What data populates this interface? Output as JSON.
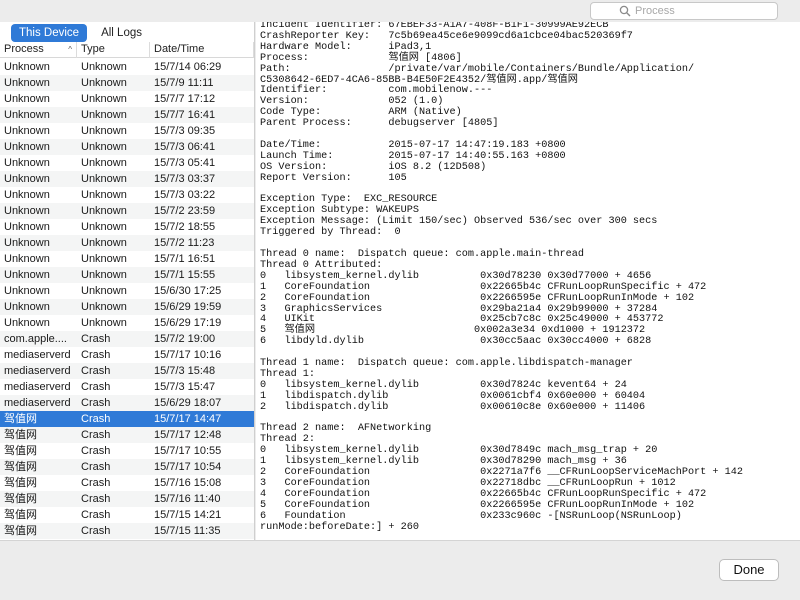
{
  "toolbar": {
    "search_placeholder": "Process",
    "search_icon": "magnifier"
  },
  "tabs": {
    "this_device": "This Device",
    "all_logs": "All Logs"
  },
  "table": {
    "columns": [
      "Process",
      "Type",
      "Date/Time"
    ],
    "sort_indicator": "^",
    "rows": [
      [
        "Unknown",
        "Unknown",
        "15/7/14 06:29"
      ],
      [
        "Unknown",
        "Unknown",
        "15/7/9 11:11"
      ],
      [
        "Unknown",
        "Unknown",
        "15/7/7 17:12"
      ],
      [
        "Unknown",
        "Unknown",
        "15/7/7 16:41"
      ],
      [
        "Unknown",
        "Unknown",
        "15/7/3 09:35"
      ],
      [
        "Unknown",
        "Unknown",
        "15/7/3 06:41"
      ],
      [
        "Unknown",
        "Unknown",
        "15/7/3 05:41"
      ],
      [
        "Unknown",
        "Unknown",
        "15/7/3 03:37"
      ],
      [
        "Unknown",
        "Unknown",
        "15/7/3 03:22"
      ],
      [
        "Unknown",
        "Unknown",
        "15/7/2 23:59"
      ],
      [
        "Unknown",
        "Unknown",
        "15/7/2 18:55"
      ],
      [
        "Unknown",
        "Unknown",
        "15/7/2 11:23"
      ],
      [
        "Unknown",
        "Unknown",
        "15/7/1 16:51"
      ],
      [
        "Unknown",
        "Unknown",
        "15/7/1 15:55"
      ],
      [
        "Unknown",
        "Unknown",
        "15/6/30 17:25"
      ],
      [
        "Unknown",
        "Unknown",
        "15/6/29 19:59"
      ],
      [
        "Unknown",
        "Unknown",
        "15/6/29 17:19"
      ],
      [
        "com.apple....",
        "Crash",
        "15/7/2 19:00"
      ],
      [
        "mediaserverd",
        "Crash",
        "15/7/17 10:16"
      ],
      [
        "mediaserverd",
        "Crash",
        "15/7/3 15:48"
      ],
      [
        "mediaserverd",
        "Crash",
        "15/7/3 15:47"
      ],
      [
        "mediaserverd",
        "Crash",
        "15/6/29 18:07"
      ],
      [
        "驾值网",
        "Crash",
        "15/7/17 14:47"
      ],
      [
        "驾值网",
        "Crash",
        "15/7/17 12:48"
      ],
      [
        "驾值网",
        "Crash",
        "15/7/17 10:55"
      ],
      [
        "驾值网",
        "Crash",
        "15/7/17 10:54"
      ],
      [
        "驾值网",
        "Crash",
        "15/7/16 15:08"
      ],
      [
        "驾值网",
        "Crash",
        "15/7/16 11:40"
      ],
      [
        "驾值网",
        "Crash",
        "15/7/15 14:21"
      ],
      [
        "驾值网",
        "Crash",
        "15/7/15 11:35"
      ]
    ],
    "selected_row": 22
  },
  "log": {
    "lines": [
      "Incident Identifier: 67EBEF33-A1A7-408F-B1F1-30999AE92ECB",
      "CrashReporter Key:   7c5b69ea45ce6e9099cd6a1cbce04bac520369f7",
      "Hardware Model:      iPad3,1",
      "Process:             驾值网 [4806]",
      "Path:                /private/var/mobile/Containers/Bundle/Application/",
      "C5308642-6ED7-4CA6-85BB-B4E50F2E4352/驾值网.app/驾值网",
      "Identifier:          com.mobilenow.---",
      "Version:             052 (1.0)",
      "Code Type:           ARM (Native)",
      "Parent Process:      debugserver [4805]",
      "",
      "Date/Time:           2015-07-17 14:47:19.183 +0800",
      "Launch Time:         2015-07-17 14:40:55.163 +0800",
      "OS Version:          iOS 8.2 (12D508)",
      "Report Version:      105",
      "",
      "Exception Type:  EXC_RESOURCE",
      "Exception Subtype: WAKEUPS",
      "Exception Message: (Limit 150/sec) Observed 536/sec over 300 secs",
      "Triggered by Thread:  0",
      "",
      "Thread 0 name:  Dispatch queue: com.apple.main-thread",
      "Thread 0 Attributed:",
      "0   libsystem_kernel.dylib          0x30d78230 0x30d77000 + 4656",
      "1   CoreFoundation                  0x22665b4c CFRunLoopRunSpecific + 472",
      "2   CoreFoundation                  0x2266595e CFRunLoopRunInMode + 102",
      "3   GraphicsServices                0x29ba21a4 0x29b99000 + 37284",
      "4   UIKit                           0x25cb7c8c 0x25c49000 + 453772",
      "5   驾值网                          0x002a3e34 0xd1000 + 1912372",
      "6   libdyld.dylib                   0x30cc5aac 0x30cc4000 + 6828",
      "",
      "Thread 1 name:  Dispatch queue: com.apple.libdispatch-manager",
      "Thread 1:",
      "0   libsystem_kernel.dylib          0x30d7824c kevent64 + 24",
      "1   libdispatch.dylib               0x0061cbf4 0x60e000 + 60404",
      "2   libdispatch.dylib               0x00610c8e 0x60e000 + 11406",
      "",
      "Thread 2 name:  AFNetworking",
      "Thread 2:",
      "0   libsystem_kernel.dylib          0x30d7849c mach_msg_trap + 20",
      "1   libsystem_kernel.dylib          0x30d78290 mach_msg + 36",
      "2   CoreFoundation                  0x2271a7f6 __CFRunLoopServiceMachPort + 142",
      "3   CoreFoundation                  0x22718dbc __CFRunLoopRun + 1012",
      "4   CoreFoundation                  0x22665b4c CFRunLoopRunSpecific + 472",
      "5   CoreFoundation                  0x2266595e CFRunLoopRunInMode + 102",
      "6   Foundation                      0x233c960c -[NSRunLoop(NSRunLoop)",
      "runMode:beforeDate:] + 260"
    ]
  },
  "footer": {
    "done_label": "Done"
  },
  "colors": {
    "selection": "#2f7ad7",
    "row_alt": "#f4f5f5"
  }
}
